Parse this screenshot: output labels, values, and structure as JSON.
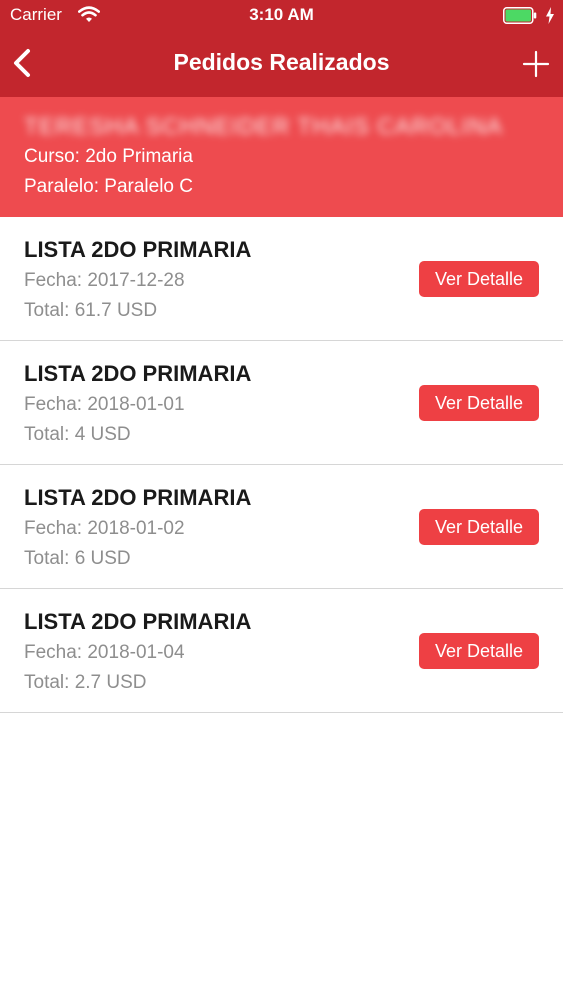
{
  "status_bar": {
    "carrier": "Carrier",
    "time": "3:10 AM"
  },
  "nav": {
    "title": "Pedidos Realizados",
    "back_icon": "chevron-left-icon",
    "add_icon": "plus-icon"
  },
  "student": {
    "name": "TERESHA SCHNEIDER THAIS CAROLINA",
    "course": "Curso: 2do Primaria",
    "section": "Paralelo: Paralelo C"
  },
  "orders": [
    {
      "title": "LISTA 2DO PRIMARIA",
      "date": "Fecha: 2017-12-28",
      "total": "Total: 61.7 USD",
      "button": "Ver Detalle"
    },
    {
      "title": "LISTA 2DO PRIMARIA",
      "date": "Fecha: 2018-01-01",
      "total": "Total: 4 USD",
      "button": "Ver Detalle"
    },
    {
      "title": "LISTA 2DO PRIMARIA",
      "date": "Fecha: 2018-01-02",
      "total": "Total: 6 USD",
      "button": "Ver Detalle"
    },
    {
      "title": "LISTA 2DO PRIMARIA",
      "date": "Fecha: 2018-01-04",
      "total": "Total: 2.7 USD",
      "button": "Ver Detalle"
    }
  ],
  "colors": {
    "nav_background": "#c2262d",
    "panel_background": "#ee4b4f",
    "button_background": "#ee4044",
    "battery": "#4cd964"
  }
}
